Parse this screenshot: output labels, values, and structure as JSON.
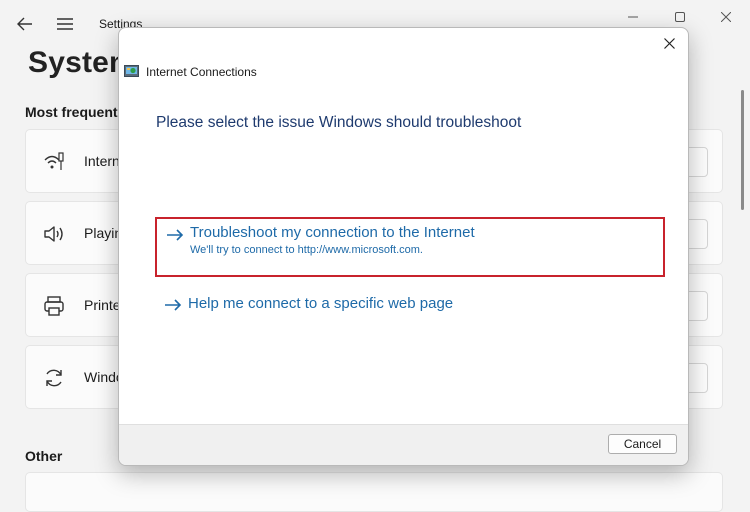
{
  "settings": {
    "app_title": "Settings",
    "page_title": "System",
    "section_frequent": "Most frequent",
    "section_other": "Other",
    "items": [
      {
        "label": "Intern",
        "icon": "wifi-network-icon"
      },
      {
        "label": "Playin",
        "icon": "speaker-icon"
      },
      {
        "label": "Printe",
        "icon": "printer-icon"
      },
      {
        "label": "Windo",
        "icon": "sync-icon"
      }
    ]
  },
  "dialog": {
    "title": "Internet Connections",
    "heading": "Please select the issue Windows should troubleshoot",
    "options": [
      {
        "title": "Troubleshoot my connection to the Internet",
        "subtitle": "We'll try to connect to http://www.microsoft.com.",
        "selected": true
      },
      {
        "title": "Help me connect to a specific web page",
        "subtitle": "",
        "selected": false
      }
    ],
    "cancel_label": "Cancel"
  },
  "colors": {
    "link": "#1e6aa8",
    "heading": "#1e3a6e",
    "highlight_border": "#c8232c",
    "background": "#f3f3f3"
  }
}
